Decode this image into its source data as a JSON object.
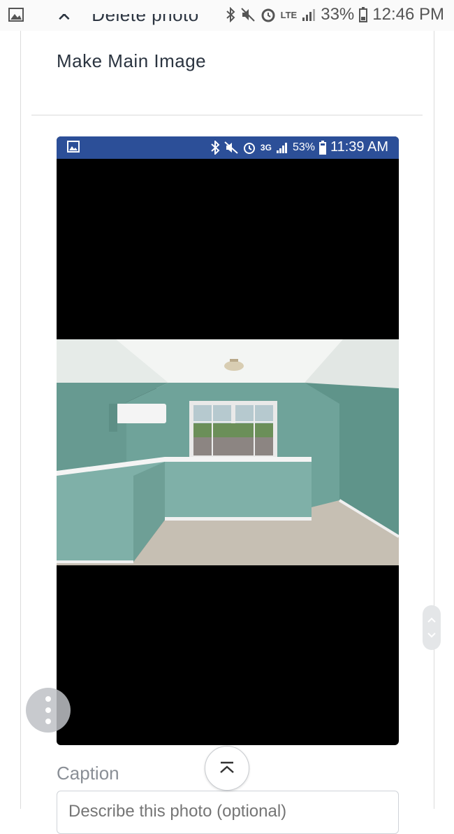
{
  "status_bar": {
    "network": "LTE",
    "battery": "33%",
    "time": "12:46 PM"
  },
  "menu": {
    "delete_photo": "Delete photo",
    "make_main_image": "Make Main Image"
  },
  "photo": {
    "inner_status": {
      "network": "3G",
      "battery": "53%",
      "time": "11:39 AM"
    }
  },
  "caption": {
    "label": "Caption",
    "placeholder": "Describe this photo (optional)"
  },
  "colors": {
    "inner_status_bg": "#2c4f98",
    "wall": "#6fa39a",
    "text": "#2b3440"
  },
  "icons": {
    "status_left": "image-icon",
    "more": "more-vertical-icon",
    "scroll_top": "chevron-up-icon"
  }
}
